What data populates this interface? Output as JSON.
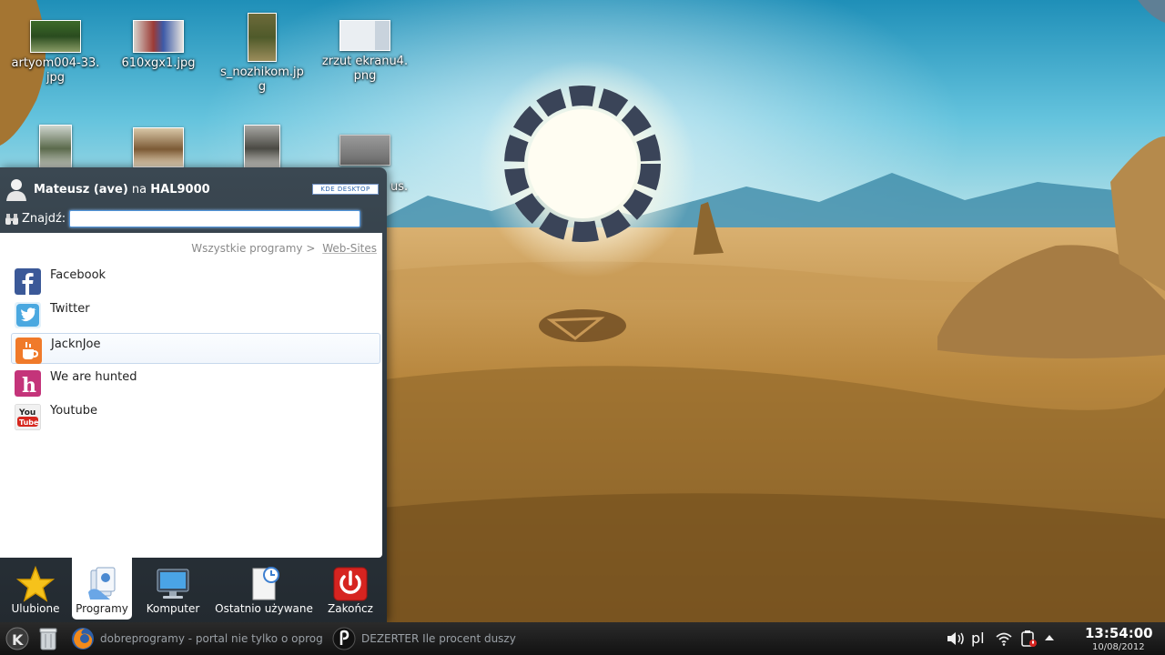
{
  "desktop_icons": [
    {
      "label": "artyom004-33.\njpg"
    },
    {
      "label": "610xgx1.jpg"
    },
    {
      "label": "s_nozhikom.jpg"
    },
    {
      "label": "zrzut ekranu4.\npng"
    },
    {
      "label": ""
    },
    {
      "label": ""
    },
    {
      "label": ""
    },
    {
      "label": "us."
    }
  ],
  "kickoff": {
    "user_name": "Mateusz (ave)",
    "user_on": "na",
    "host": "HAL9000",
    "kde_badge": "KDE DESKTOP",
    "search_label": "Znajdź:",
    "search_value": "",
    "breadcrumb": [
      "Wszystkie programy >",
      "Web-Sites"
    ],
    "apps": [
      {
        "name": "Facebook",
        "icon": "facebook-icon",
        "color": "#3b5998"
      },
      {
        "name": "Twitter",
        "icon": "twitter-icon",
        "color": "#4aa8e0"
      },
      {
        "name": "JacknJoe",
        "icon": "jacknjoe-icon",
        "color": "#f07a2a"
      },
      {
        "name": "We are hunted",
        "icon": "wearehunted-icon",
        "color": "#c4347a"
      },
      {
        "name": "Youtube",
        "icon": "youtube-icon",
        "color": "#d6271e"
      }
    ],
    "tabs": [
      {
        "label": "Ulubione",
        "icon": "star-icon"
      },
      {
        "label": "Programy",
        "icon": "applications-icon"
      },
      {
        "label": "Komputer",
        "icon": "computer-icon"
      },
      {
        "label": "Ostatnio używane",
        "icon": "recent-icon"
      },
      {
        "label": "Zakończ",
        "icon": "power-icon"
      }
    ],
    "active_tab": "Programy"
  },
  "taskbar": {
    "tasks": [
      {
        "label": "dobreprogramy - portal nie tylko o oprogram",
        "icon": "firefox-icon"
      },
      {
        "label": "DEZERTER Ile procent duszy",
        "icon": "music-player-icon"
      }
    ],
    "keyboard_layout": "pl",
    "time": "13:54:00",
    "date": "10/08/2012"
  }
}
